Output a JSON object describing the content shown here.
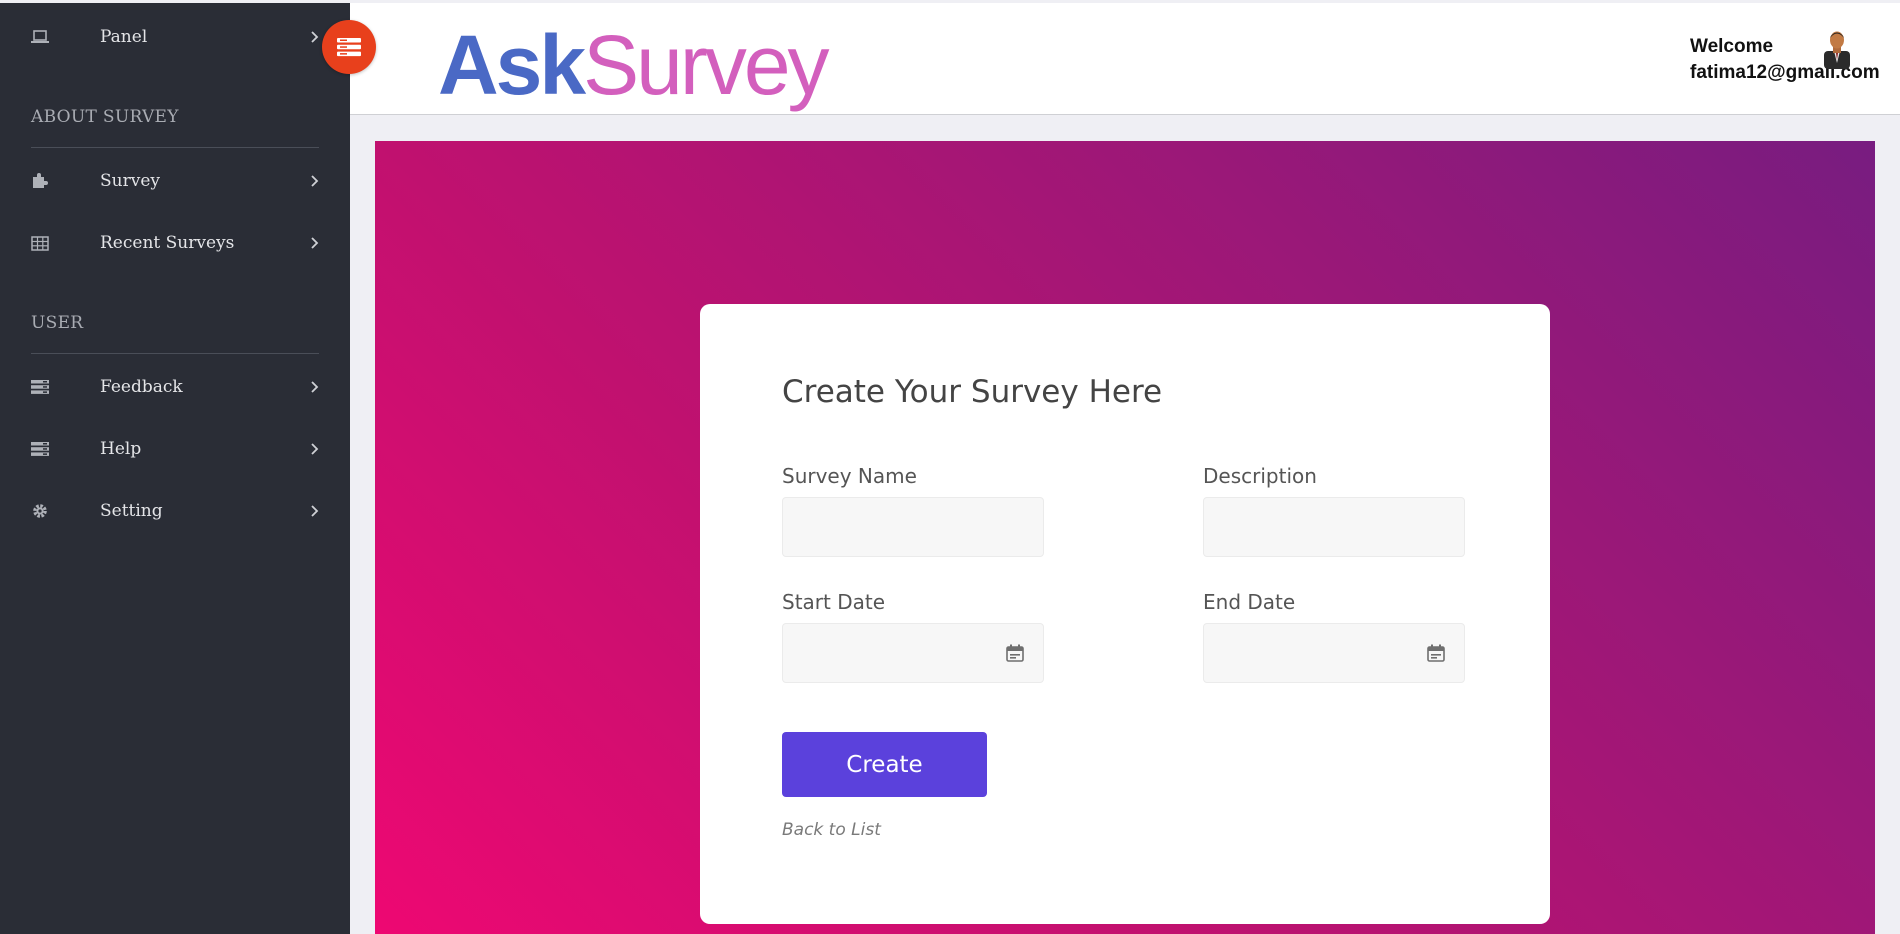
{
  "sidebar": {
    "panel_label": "Panel",
    "section_about": "ABOUT SURVEY",
    "section_user": "USER",
    "items": [
      {
        "label": "Survey",
        "icon": "puzzle-icon"
      },
      {
        "label": "Recent Surveys",
        "icon": "table-icon"
      },
      {
        "label": "Feedback",
        "icon": "server-icon"
      },
      {
        "label": "Help",
        "icon": "server-icon"
      },
      {
        "label": "Setting",
        "icon": "gear-icon"
      }
    ]
  },
  "header": {
    "logo_ask": "Ask",
    "logo_survey": "Survey",
    "welcome": "Welcome",
    "email": "fatima12@gmail.com"
  },
  "form": {
    "title": "Create Your Survey Here",
    "survey_name_label": "Survey Name",
    "description_label": "Description",
    "start_date_label": "Start Date",
    "end_date_label": "End Date",
    "survey_name_value": "",
    "description_value": "",
    "start_date_value": "",
    "end_date_value": "",
    "create_label": "Create",
    "back_label": "Back to List"
  },
  "colors": {
    "sidebar_bg": "#2a2d36",
    "toggle_accent": "#e8401c",
    "button_primary": "#5b41dc",
    "gradient_start": "#ee0872",
    "gradient_end": "#781c80",
    "logo_ask": "#4a69c5",
    "logo_survey": "#d35fbd"
  }
}
